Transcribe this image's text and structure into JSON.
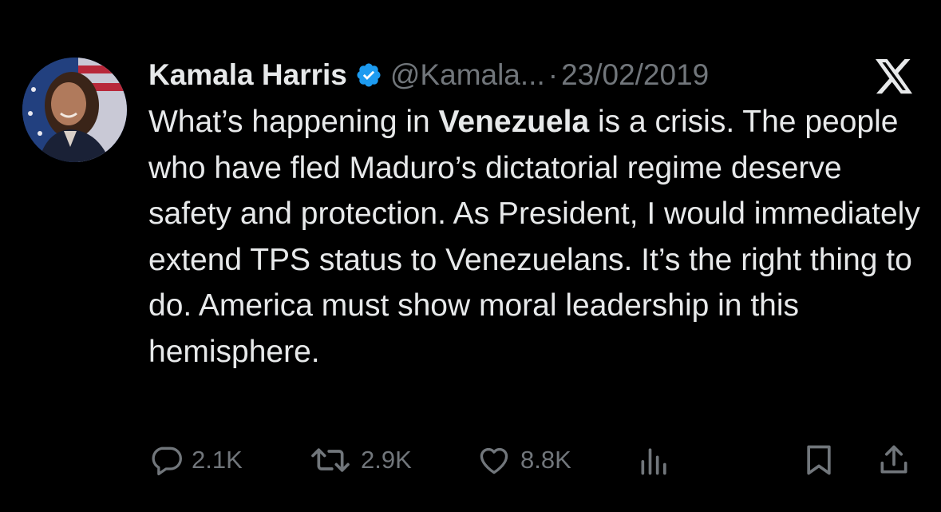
{
  "author": {
    "display_name": "Kamala Harris",
    "handle": "@Kamala...",
    "separator": "·",
    "date": "23/02/2019",
    "verified": true
  },
  "tweet": {
    "text_before": "What’s happening in ",
    "text_bold": "Venezuela",
    "text_after": " is a crisis. The people who have fled Maduro’s dictatorial regime deserve safety and protection. As President, I would immediately extend TPS status to Venezuelans. It’s the right thing to do. America must show moral leadership in this hemisphere."
  },
  "actions": {
    "replies": "2.1K",
    "reposts": "2.9K",
    "likes": "8.8K"
  },
  "icons": {
    "platform_logo": "x-logo-icon",
    "verified": "verified-badge-icon",
    "reply": "reply-icon",
    "repost": "repost-icon",
    "like": "heart-icon",
    "views": "views-chart-icon",
    "bookmark": "bookmark-icon",
    "share": "share-icon"
  },
  "colors": {
    "background": "#000000",
    "text": "#e7e9ea",
    "muted": "#71767b",
    "verified": "#1d9bf0"
  }
}
